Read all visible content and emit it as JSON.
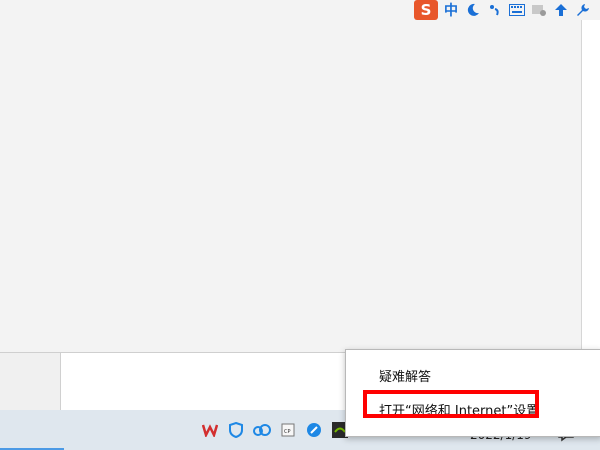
{
  "ime_toolbar": {
    "logo_text": "S",
    "mode_label": "中",
    "icons": [
      "sogou-logo-icon",
      "chinese-mode-icon",
      "moon-icon",
      "punctuation-icon",
      "keyboard-icon",
      "skin-icon",
      "upload-icon",
      "wrench-icon"
    ]
  },
  "context_menu": {
    "items": [
      {
        "label": "疑难解答"
      },
      {
        "label": "打开“网络和 Internet”设置"
      }
    ]
  },
  "taskbar": {
    "tray_icons": [
      "wps-icon",
      "shield-icon",
      "cloud-icon",
      "clipboard-icon",
      "feather-icon",
      "nvidia-icon",
      "network-icon",
      "volume-icon",
      "microphone-icon",
      "battery-icon",
      "app-icon"
    ],
    "date": "2022/1/19"
  },
  "colors": {
    "highlight": "#ff0000",
    "sogou": "#e8562a",
    "accent_blue": "#1a6fd6",
    "taskbar": "#dfe7ee"
  }
}
